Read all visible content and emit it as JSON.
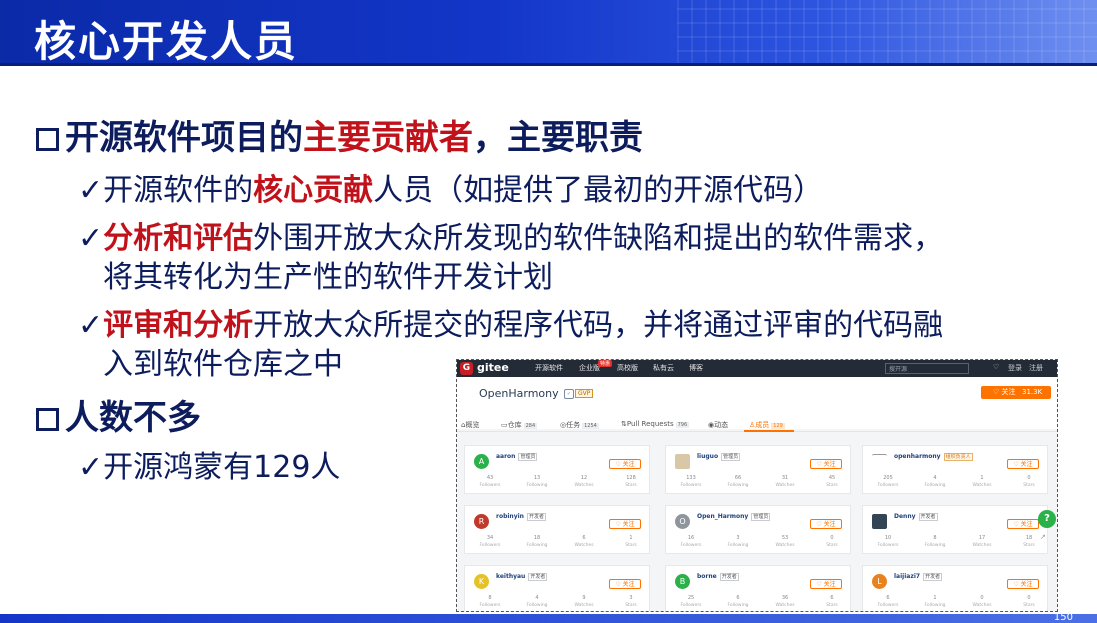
{
  "slide": {
    "title": "核心开发人员",
    "bullet1_pre": "开源软件项目的",
    "bullet1_red": "主要贡献者",
    "bullet1_post": "，主要职责",
    "sub1_pre": "开源软件的",
    "sub1_red": "核心贡献",
    "sub1_post": "人员（如提供了最初的开源代码）",
    "sub2_red": "分析和评估",
    "sub2_post": "外围开放大众所发现的软件缺陷和提出的软件需求，",
    "sub2_cont": "将其转化为生产性的软件开发计划",
    "sub3_red": "评审和分析",
    "sub3_post": "开放大众所提交的程序代码，并将通过评审的代码融",
    "sub3_cont": "入到软件仓库之中",
    "bullet2": "人数不多",
    "sub4": "开源鸿蒙有129人",
    "check": "✓",
    "page_number": "150"
  },
  "gitee": {
    "brand": "gitee",
    "logo_letter": "G",
    "nav": [
      "开源软件",
      "企业版",
      "高校版",
      "私有云",
      "博客"
    ],
    "nav_badge": "特惠",
    "search_placeholder": "搜开源",
    "login": "登录",
    "register": "注册",
    "org_name": "OpenHarmony",
    "gvp": "GVP",
    "follow_label": "♡ 关注",
    "follow_count": "31.3K",
    "tabs": [
      {
        "label": "概览",
        "icon": "⌂",
        "count": ""
      },
      {
        "label": "仓库",
        "icon": "▭",
        "count": "284"
      },
      {
        "label": "任务",
        "icon": "◎",
        "count": "1254"
      },
      {
        "label": "Pull Requests",
        "icon": "⇅",
        "count": "796"
      },
      {
        "label": "动态",
        "icon": "◉",
        "count": ""
      },
      {
        "label": "成员",
        "icon": "♙",
        "count": "129"
      }
    ],
    "follow_btn": "♡ 关注",
    "stat_labels": [
      "Followers",
      "Following",
      "Watches",
      "Stars"
    ],
    "members": [
      {
        "name": "aaron",
        "role": "管理员",
        "avatar": "A",
        "color": "#2bb14a",
        "stats": [
          "43",
          "13",
          "12",
          "128"
        ]
      },
      {
        "name": "liuguo",
        "role": "管理员",
        "avatar": "",
        "color": "#d9c8a8",
        "stats": [
          "133",
          "66",
          "31",
          "45"
        ]
      },
      {
        "name": "openharmony",
        "role": "组织负责人",
        "avatar": "",
        "color": "#ffffff",
        "stats": [
          "205",
          "4",
          "1",
          "0"
        ]
      },
      {
        "name": "robinyin",
        "role": "开发者",
        "avatar": "R",
        "color": "#c0392b",
        "stats": [
          "34",
          "18",
          "6",
          "1"
        ]
      },
      {
        "name": "Open_Harmony",
        "role": "管理员",
        "avatar": "O",
        "color": "#8e959c",
        "stats": [
          "16",
          "3",
          "53",
          "0"
        ]
      },
      {
        "name": "Denny",
        "role": "开发者",
        "avatar": "",
        "color": "#334455",
        "stats": [
          "10",
          "8",
          "17",
          "18"
        ]
      },
      {
        "name": "keithyau",
        "role": "开发者",
        "avatar": "K",
        "color": "#e6c229",
        "stats": [
          "8",
          "4",
          "9",
          "3"
        ]
      },
      {
        "name": "borne",
        "role": "开发者",
        "avatar": "B",
        "color": "#2bb14a",
        "stats": [
          "25",
          "6",
          "36",
          "6"
        ]
      },
      {
        "name": "laijiazi7",
        "role": "开发者",
        "avatar": "L",
        "color": "#e8821e",
        "stats": [
          "6",
          "1",
          "0",
          "0"
        ]
      }
    ],
    "help": "?",
    "side_icon": "↗"
  },
  "colors": {
    "accent_red": "#c0121b",
    "navy": "#0c1c5c",
    "gitee_orange": "#fe7300",
    "banner_blue": "#1336c9"
  }
}
